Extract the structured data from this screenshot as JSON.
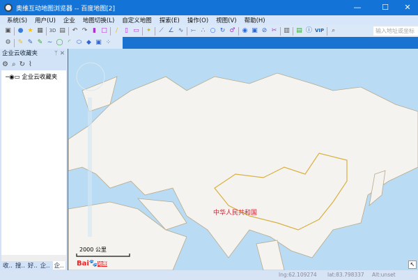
{
  "window": {
    "title": "奥维互动地图浏览器 -- 百度地图[2]",
    "minimize": "—",
    "maximize": "☐",
    "close": "✕"
  },
  "menu": [
    "系统(S)",
    "用户(U)",
    "企业",
    "地图切换(L)",
    "自定义地图",
    "探索(E)",
    "操作(O)",
    "视图(V)",
    "帮助(H)"
  ],
  "toolbar": {
    "search_placeholder": "输入地址或坐标",
    "label_3d": "3D",
    "label_vip": "VIP"
  },
  "panel": {
    "title": "企业云收藏夹",
    "pin": "ᛘ",
    "close": "✕",
    "tree_node": "企业云收藏夹",
    "tabs": [
      "收..",
      "搜..",
      "好..",
      "企..",
      "企.."
    ]
  },
  "map": {
    "country_label": "中华人民共和国",
    "scale_label": "2000 公里",
    "logo_text": "Bai",
    "logo_text2": "地图",
    "colors": {
      "ocean": "#b9dcf4",
      "land": "#f5f3ef",
      "border": "#b8a98a",
      "china_border": "#d8b040"
    }
  },
  "status": {
    "lng": "lng:62.109274",
    "lat": "lat:83.798337",
    "alt": "Alt:unset"
  }
}
